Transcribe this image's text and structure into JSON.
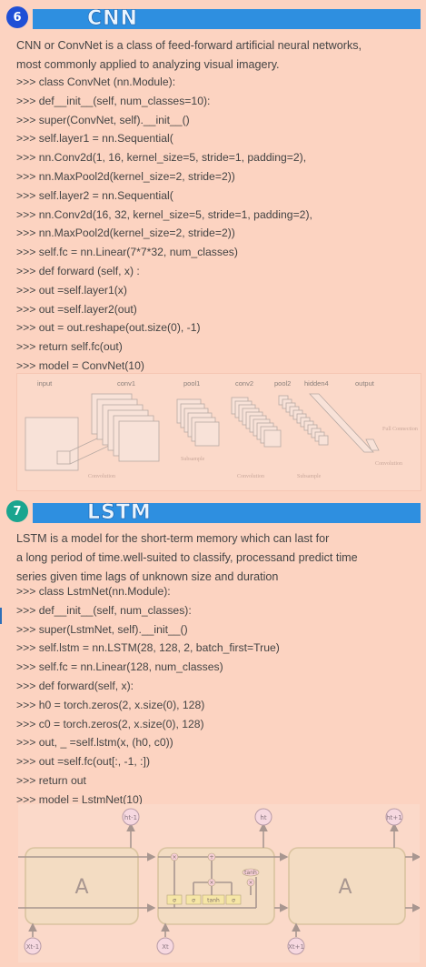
{
  "cnn": {
    "number": "6",
    "title": "CNN",
    "description_lines": [
      "CNN or ConvNet is a class of feed-forward artificial neural networks,",
      "most commonly applied to analyzing visual imagery."
    ],
    "code": [
      ">>> class ConvNet (nn.Module):",
      ">>> def__init__(self, num_classes=10):",
      ">>> super(ConvNet, self).__init__()",
      ">>> self.layer1 = nn.Sequential(",
      ">>> nn.Conv2d(1, 16, kernel_size=5, stride=1, padding=2),",
      ">>> nn.MaxPool2d(kernel_size=2, stride=2))",
      ">>> self.layer2 = nn.Sequential(",
      ">>> nn.Conv2d(16, 32, kernel_size=5, stride=1, padding=2),",
      ">>> nn.MaxPool2d(kernel_size=2, stride=2))",
      ">>> self.fc = nn.Linear(7*7*32, num_classes)",
      ">>> def forward (self, x) :",
      ">>> out =self.layer1(x)",
      ">>> out =self.layer2(out)",
      ">>> out = out.reshape(out.size(0), -1)",
      ">>> return self.fc(out)",
      ">>> model = ConvNet(10)"
    ],
    "diagram": {
      "layer_labels": [
        "input",
        "conv1",
        "pool1",
        "conv2",
        "pool2",
        "hidden4",
        "output"
      ],
      "op_labels": [
        "Convolution",
        "Subsample",
        "Convolution",
        "Subsample",
        "Convolution",
        "Full Connection"
      ]
    }
  },
  "lstm": {
    "number": "7",
    "title": "LSTM",
    "description_lines": [
      "LSTM is a model for the short-term memory which can last for",
      "a long period of time.well-suited to classify, processand predict time",
      "series given time lags of unknown size and duration"
    ],
    "code": [
      ">>> class LstmNet(nn.Module):",
      ">>> def__init__(self, num_classes):",
      ">>> super(LstmNet, self).__init__()",
      ">>> self.lstm = nn.LSTM(28, 128, 2, batch_first=True)",
      ">>> self.fc = nn.Linear(128, num_classes)",
      ">>> def forward(self, x):",
      ">>> h0 = torch.zeros(2, x.size(0), 128)",
      ">>> c0 = torch.zeros(2, x.size(0), 128)",
      ">>> out, _ =self.lstm(x, (h0, c0))",
      ">>> out =self.fc(out[:, -1, :])",
      ">>> return out",
      ">>> model = LstmNet(10)"
    ],
    "diagram": {
      "cell_label": "A",
      "outputs": [
        "ht-1",
        "ht",
        "ht+1"
      ],
      "inputs": [
        "Xt-1",
        "Xt",
        "Xt+1"
      ],
      "gate_labels": [
        "σ",
        "σ",
        "tanh",
        "σ"
      ],
      "ops": [
        "×",
        "+",
        "×",
        "×",
        "tanh"
      ]
    }
  },
  "colors": {
    "background": "#fcd3c1",
    "header_bar": "#2e8fe0",
    "badge_cnn": "#1f4fd6",
    "badge_lstm": "#1aa58f",
    "text": "#444444"
  }
}
